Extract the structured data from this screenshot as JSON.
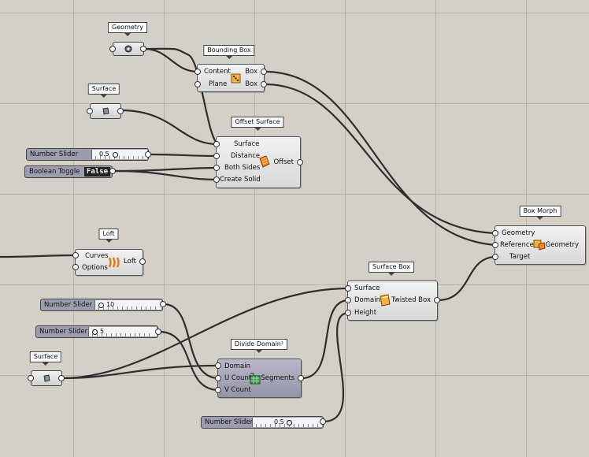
{
  "tags": {
    "geometry": "Geometry",
    "bounding_box": "Bounding Box",
    "surface_top": "Surface",
    "offset_surface": "Offset Surface",
    "loft": "Loft",
    "box_morph": "Box Morph",
    "surface_box": "Surface Box",
    "surface_bottom": "Surface",
    "divide_domain": "Divide Domain²"
  },
  "bounding_box": {
    "inputs": [
      "Content",
      "Plane"
    ],
    "outputs": [
      "Box",
      "Box"
    ]
  },
  "offset_surface": {
    "inputs": [
      "Surface",
      "Distance",
      "Both Sides",
      "Create Solid"
    ],
    "output": "Offset"
  },
  "loft": {
    "inputs": [
      "Curves",
      "Options"
    ],
    "output": "Loft"
  },
  "box_morph": {
    "inputs": [
      "Geometry",
      "Reference",
      "Target"
    ],
    "output": "Geometry"
  },
  "surface_box": {
    "inputs": [
      "Surface",
      "Domain",
      "Height"
    ],
    "output": "Twisted Box"
  },
  "divide_domain": {
    "inputs": [
      "Domain",
      "U Count",
      "V Count"
    ],
    "output": "Segments"
  },
  "sliders": {
    "offset_distance": {
      "label": "Number Slider",
      "value": "0.5",
      "fraction": 0.5
    },
    "u_count": {
      "label": "Number Slider",
      "value": "10",
      "fraction": 0.1
    },
    "v_count": {
      "label": "Number Slider",
      "value": "5",
      "fraction": 0.05
    },
    "height": {
      "label": "Number Slider",
      "value": "0.5",
      "fraction": 0.5
    }
  },
  "toggle": {
    "label": "Boolean Toggle",
    "value": "False"
  },
  "colors": {
    "canvas": "#d4d0c8",
    "wire": "#2e2e2e",
    "selected_component": "#9494a8"
  }
}
